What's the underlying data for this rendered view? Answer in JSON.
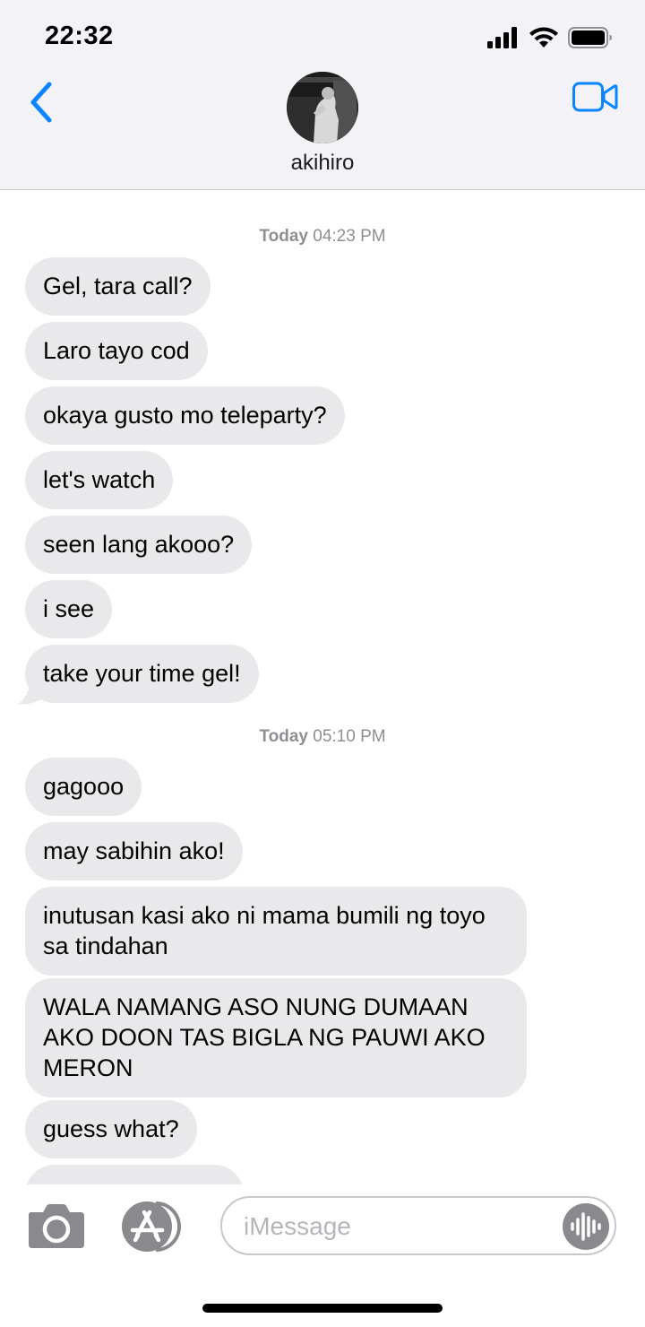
{
  "status_bar": {
    "time": "22:32"
  },
  "header": {
    "contact_name": "akihiro"
  },
  "icons": {
    "back": "chevron-left-icon",
    "video": "video-camera-icon",
    "camera": "camera-icon",
    "apps": "app-store-icon",
    "voice": "waveform-icon"
  },
  "colors": {
    "accent": "#0a84ff",
    "bubble_received": "#e9e9eb",
    "timestamp": "#8e8e93"
  },
  "groups": [
    {
      "timestamp_day": "Today",
      "timestamp_time": "04:23 PM",
      "messages": [
        "Gel, tara call?",
        "Laro tayo cod",
        "okaya gusto mo teleparty?",
        "let's watch",
        "seen lang akooo?",
        "i see",
        "take your time gel!"
      ]
    },
    {
      "timestamp_day": "Today",
      "timestamp_time": "05:10 PM",
      "messages": [
        "gagooo",
        "may sabihin ako!",
        "inutusan kasi ako ni mama bumili ng toyo sa tindahan",
        "WALA NAMANG ASO NUNG DUMAAN AKO DOON TAS BIGLA NG PAUWI AKO MERON",
        "guess what?",
        ""
      ]
    }
  ],
  "composer": {
    "placeholder": "iMessage"
  }
}
